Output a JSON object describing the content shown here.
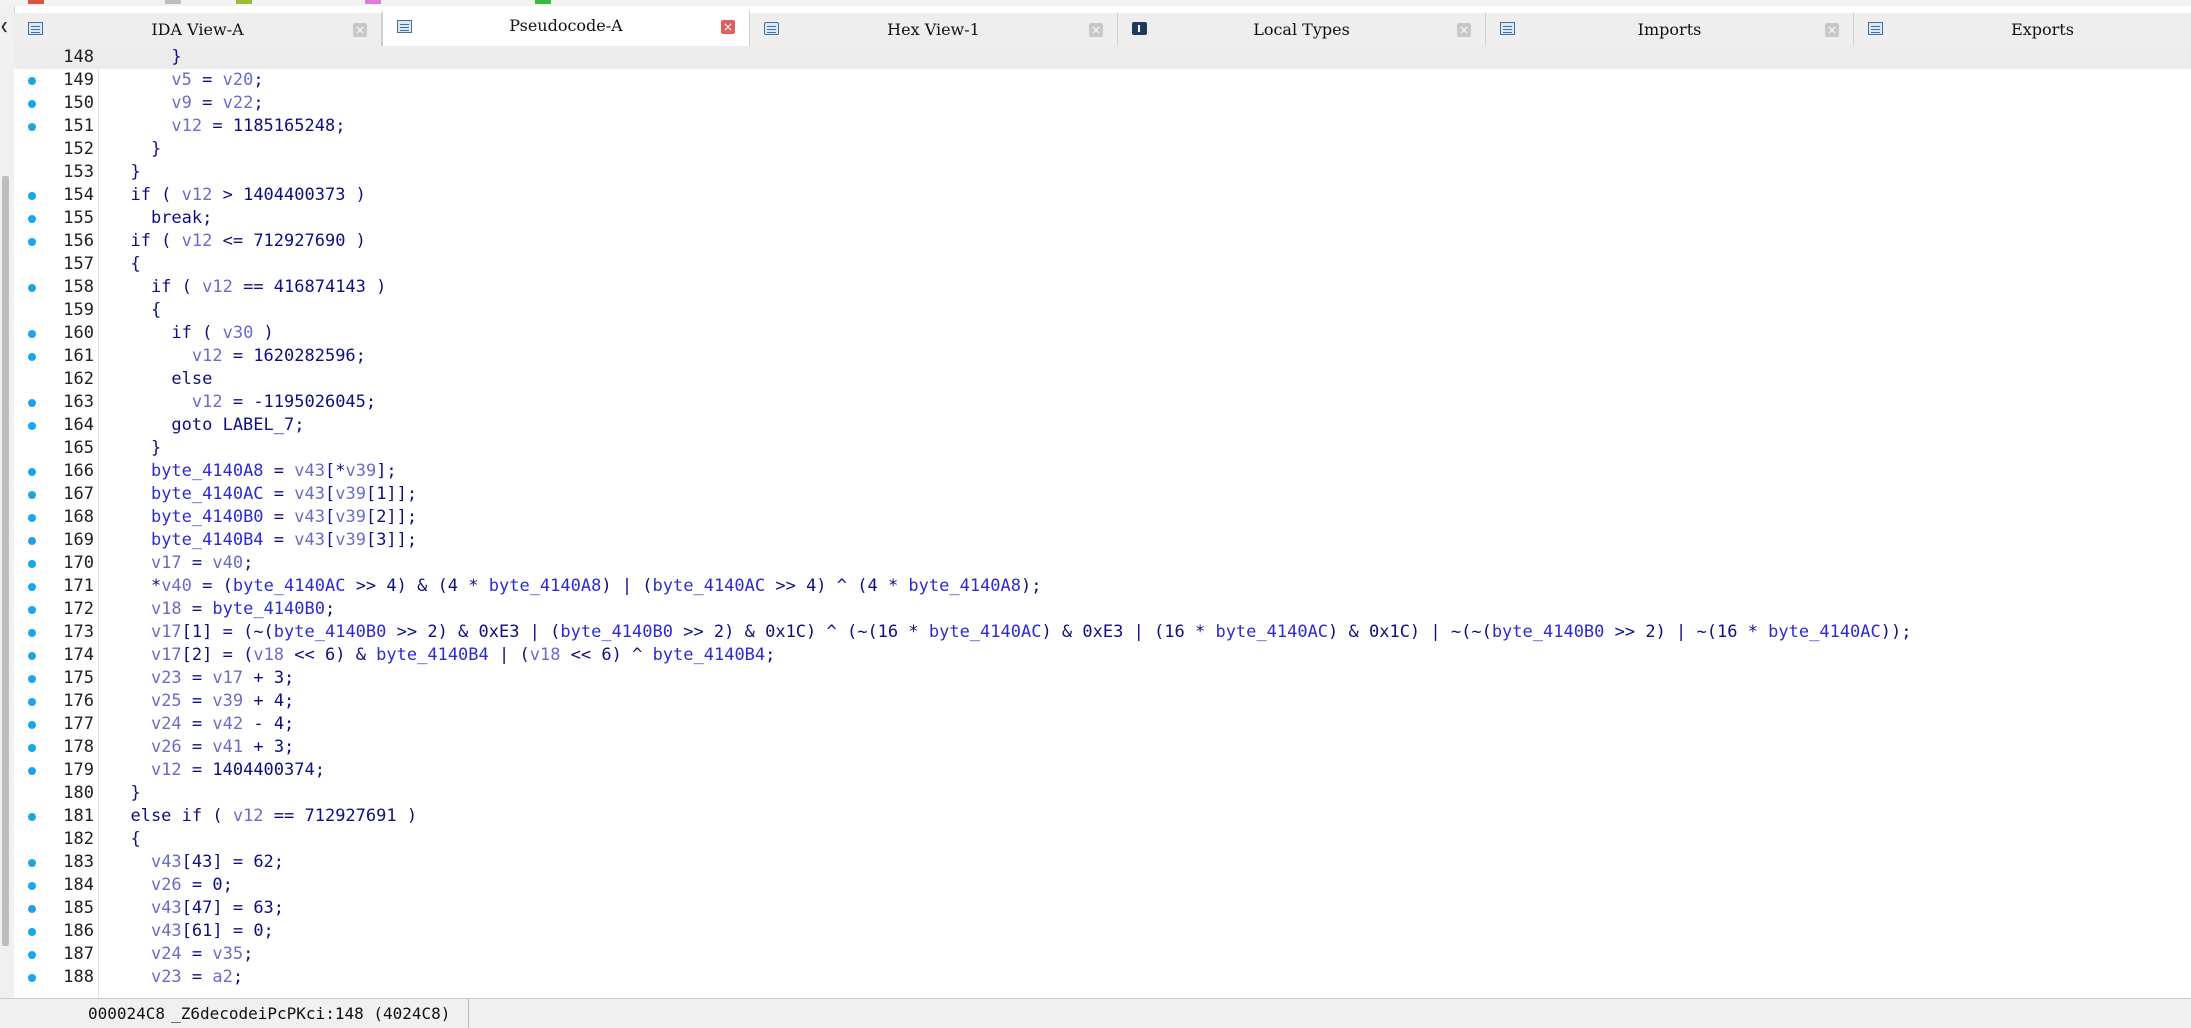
{
  "tabs": [
    {
      "label": "IDA View-A",
      "icon": "ida-view-icon",
      "active": false
    },
    {
      "label": "Pseudocode-A",
      "icon": "pseudocode-icon",
      "active": true
    },
    {
      "label": "Hex View-1",
      "icon": "hex-view-icon",
      "active": false
    },
    {
      "label": "Local Types",
      "icon": "local-types-icon",
      "active": false
    },
    {
      "label": "Imports",
      "icon": "imports-icon",
      "active": false
    },
    {
      "label": "Exports",
      "icon": "exports-icon",
      "active": false
    }
  ],
  "tab_close_glyph": "×",
  "collapse_glyph": "❮",
  "accent_colors": {
    "breakpoint_dot": "#1fa4e6",
    "active_tab_close": "#e06060",
    "keyword": "#0e0e84",
    "variable": "#6b6bc8"
  },
  "lines": [
    {
      "num": "148",
      "text": "      }"
    },
    {
      "num": "149",
      "text": "      v5 = v20;"
    },
    {
      "num": "150",
      "text": "      v9 = v22;"
    },
    {
      "num": "151",
      "text": "      v12 = 1185165248;"
    },
    {
      "num": "152",
      "text": "    }"
    },
    {
      "num": "153",
      "text": "  }"
    },
    {
      "num": "154",
      "text": "  if ( v12 > 1404400373 )"
    },
    {
      "num": "155",
      "text": "    break;"
    },
    {
      "num": "156",
      "text": "  if ( v12 <= 712927690 )"
    },
    {
      "num": "157",
      "text": "  {"
    },
    {
      "num": "158",
      "text": "    if ( v12 == 416874143 )"
    },
    {
      "num": "159",
      "text": "    {"
    },
    {
      "num": "160",
      "text": "      if ( v30 )"
    },
    {
      "num": "161",
      "text": "        v12 = 1620282596;"
    },
    {
      "num": "162",
      "text": "      else"
    },
    {
      "num": "163",
      "text": "        v12 = -1195026045;"
    },
    {
      "num": "164",
      "text": "      goto LABEL_7;"
    },
    {
      "num": "165",
      "text": "    }"
    },
    {
      "num": "166",
      "text": "    byte_4140A8 = v43[*v39];"
    },
    {
      "num": "167",
      "text": "    byte_4140AC = v43[v39[1]];"
    },
    {
      "num": "168",
      "text": "    byte_4140B0 = v43[v39[2]];"
    },
    {
      "num": "169",
      "text": "    byte_4140B4 = v43[v39[3]];"
    },
    {
      "num": "170",
      "text": "    v17 = v40;"
    },
    {
      "num": "171",
      "text": "    *v40 = (byte_4140AC >> 4) & (4 * byte_4140A8) | (byte_4140AC >> 4) ^ (4 * byte_4140A8);"
    },
    {
      "num": "172",
      "text": "    v18 = byte_4140B0;"
    },
    {
      "num": "173",
      "text": "    v17[1] = (~(byte_4140B0 >> 2) & 0xE3 | (byte_4140B0 >> 2) & 0x1C) ^ (~(16 * byte_4140AC) & 0xE3 | (16 * byte_4140AC) & 0x1C) | ~(~(byte_4140B0 >> 2) | ~(16 * byte_4140AC));"
    },
    {
      "num": "174",
      "text": "    v17[2] = (v18 << 6) & byte_4140B4 | (v18 << 6) ^ byte_4140B4;"
    },
    {
      "num": "175",
      "text": "    v23 = v17 + 3;"
    },
    {
      "num": "176",
      "text": "    v25 = v39 + 4;"
    },
    {
      "num": "177",
      "text": "    v24 = v42 - 4;"
    },
    {
      "num": "178",
      "text": "    v26 = v41 + 3;"
    },
    {
      "num": "179",
      "text": "    v12 = 1404400374;"
    },
    {
      "num": "180",
      "text": "  }"
    },
    {
      "num": "181",
      "text": "  else if ( v12 == 712927691 )"
    },
    {
      "num": "182",
      "text": "  {"
    },
    {
      "num": "183",
      "text": "    v43[43] = 62;"
    },
    {
      "num": "184",
      "text": "    v26 = 0;"
    },
    {
      "num": "185",
      "text": "    v43[47] = 63;"
    },
    {
      "num": "186",
      "text": "    v43[61] = 0;"
    },
    {
      "num": "187",
      "text": "    v24 = v35;"
    },
    {
      "num": "188",
      "text": "    v23 = a2;"
    }
  ],
  "breakpoint_lines": [
    "149",
    "150",
    "151",
    "154",
    "155",
    "156",
    "158",
    "160",
    "161",
    "163",
    "164",
    "166",
    "167",
    "168",
    "169",
    "170",
    "171",
    "172",
    "173",
    "174",
    "175",
    "176",
    "177",
    "178",
    "179",
    "181",
    "183",
    "184",
    "185",
    "186",
    "187",
    "188"
  ],
  "status": {
    "address": "000024C8",
    "location": "_Z6decodeiPcPKci:148 (4024C8)"
  }
}
